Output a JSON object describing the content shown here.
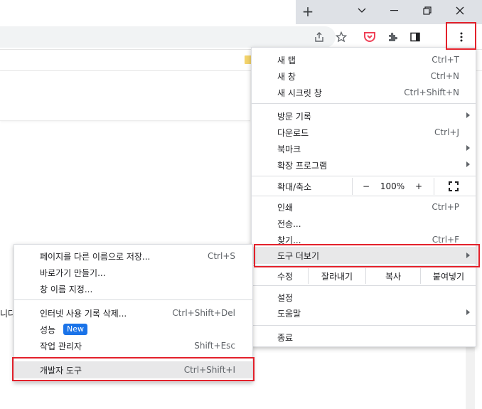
{
  "window": {
    "new_tab_icon": "plus-icon",
    "controls": [
      "chevron-down-icon",
      "minimize-icon",
      "restore-icon",
      "close-icon"
    ]
  },
  "toolbar": {
    "icons": [
      "share-icon",
      "star-icon",
      "pocket-icon",
      "extensions-icon",
      "side-panel-icon",
      "more-vert-icon"
    ]
  },
  "page": {
    "fragment_text": "니다"
  },
  "main_menu": {
    "new_tab": {
      "label": "새 탭",
      "shortcut": "Ctrl+T"
    },
    "new_window": {
      "label": "새 창",
      "shortcut": "Ctrl+N"
    },
    "new_incognito": {
      "label": "새 시크릿 창",
      "shortcut": "Ctrl+Shift+N"
    },
    "history": {
      "label": "방문 기록"
    },
    "downloads": {
      "label": "다운로드",
      "shortcut": "Ctrl+J"
    },
    "bookmarks": {
      "label": "북마크"
    },
    "extensions": {
      "label": "확장 프로그램"
    },
    "zoom": {
      "label": "확대/축소",
      "minus": "−",
      "value": "100%",
      "plus": "+",
      "fullscreen_icon": "fullscreen-icon"
    },
    "print": {
      "label": "인쇄",
      "shortcut": "Ctrl+P"
    },
    "cast": {
      "label": "전송..."
    },
    "find": {
      "label": "찾기...",
      "shortcut": "Ctrl+F"
    },
    "more_tools": {
      "label": "도구 더보기"
    },
    "edit": {
      "label": "수정",
      "cut": "잘라내기",
      "copy": "복사",
      "paste": "붙여넣기"
    },
    "settings": {
      "label": "설정"
    },
    "help": {
      "label": "도움말"
    },
    "exit": {
      "label": "종료"
    }
  },
  "submenu": {
    "save_page": {
      "label": "페이지를 다른 이름으로 저장...",
      "shortcut": "Ctrl+S"
    },
    "create_shortcut": {
      "label": "바로가기 만들기..."
    },
    "name_window": {
      "label": "창 이름 지정..."
    },
    "clear_data": {
      "label": "인터넷 사용 기록 삭제...",
      "shortcut": "Ctrl+Shift+Del"
    },
    "performance": {
      "label": "성능",
      "badge": "New"
    },
    "task_manager": {
      "label": "작업 관리자",
      "shortcut": "Shift+Esc"
    },
    "dev_tools": {
      "label": "개발자 도구",
      "shortcut": "Ctrl+Shift+I"
    }
  },
  "colors": {
    "highlight_box": "#e3212b",
    "badge_blue": "#1a73e8",
    "menu_hover": "#e8e8e9"
  }
}
